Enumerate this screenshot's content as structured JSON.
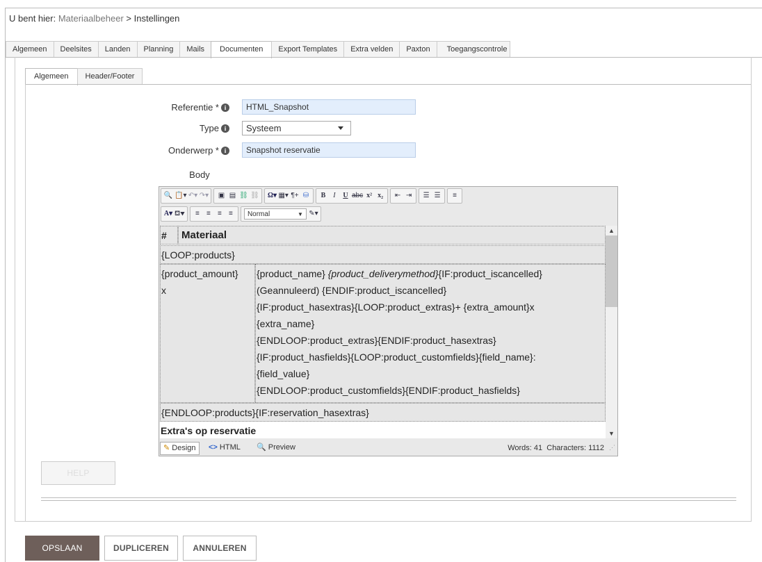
{
  "breadcrumb": {
    "prefix": "U bent hier: ",
    "parent": "Materiaalbeheer",
    "sep": " > ",
    "current": "Instellingen"
  },
  "main_tabs": [
    "Algemeen",
    "Deelsites",
    "Landen",
    "Planning",
    "Mails",
    "Documenten",
    "Export Templates",
    "Extra velden",
    "Paxton",
    "Toegangscontrole"
  ],
  "main_tab_active": "Documenten",
  "sub_tabs": [
    "Algemeen",
    "Header/Footer"
  ],
  "sub_tab_active": "Algemeen",
  "form": {
    "referentie_label": "Referentie *",
    "referentie_value": "HTML_Snapshot",
    "type_label": "Type",
    "type_value": "Systeem",
    "onderwerp_label": "Onderwerp *",
    "onderwerp_value": "Snapshot reservatie",
    "body_label": "Body"
  },
  "editor": {
    "format_select": "Normal",
    "content": {
      "header_hash": "#",
      "header_title": "Materiaal",
      "loop_start": "{LOOP:products}",
      "amount_cell": "{product_amount}",
      "amount_x": "x",
      "product_line_1a": "{product_name} ",
      "product_line_1b": "{product_deliverymethod}",
      "product_line_1c": "{IF:product_iscancelled}",
      "product_line_2": "(Geannuleerd) {ENDIF:product_iscancelled}",
      "product_line_3": "{IF:product_hasextras}{LOOP:product_extras}+ {extra_amount}x",
      "product_line_4": "{extra_name}",
      "product_line_5": "{ENDLOOP:product_extras}{ENDIF:product_hasextras}",
      "product_line_6": "{IF:product_hasfields}{LOOP:product_customfields}{field_name}:",
      "product_line_7": "{field_value}",
      "product_line_8": "{ENDLOOP:product_customfields}{ENDIF:product_hasfields}",
      "loop_end": "{ENDLOOP:products}{IF:reservation_hasextras}",
      "extras_heading": "Extra's op reservatie"
    },
    "modes": {
      "design": "Design",
      "html": "HTML",
      "preview": "Preview"
    },
    "words": "Words: 41",
    "characters": "Characters: 1112"
  },
  "buttons": {
    "help": "HELP",
    "save": "OPSLAAN",
    "duplicate": "DUPLICEREN",
    "cancel": "ANNULEREN"
  },
  "colors": {
    "input_bg": "#e3eefc",
    "save_bg": "#6e5f5a"
  }
}
